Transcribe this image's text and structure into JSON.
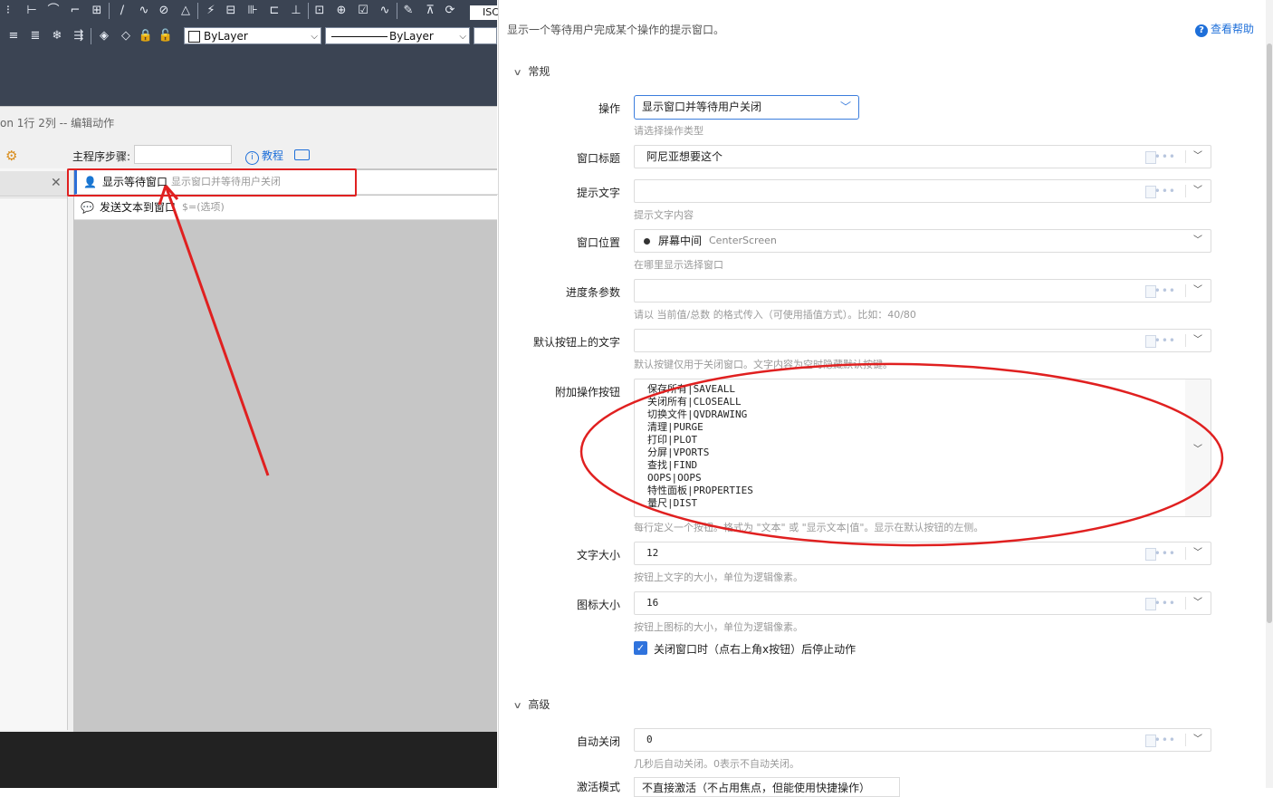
{
  "cad_toolbar": {
    "layer_combo": "ByLayer",
    "linetype_combo": "ByLayer",
    "cut_text": "ISC",
    "icons_row1": [
      "point-icon",
      "line-icon",
      "arc-icon",
      "dimension-icon",
      "polyline-icon",
      "arc2-icon",
      "circle-icon",
      "triangle-icon",
      "break-icon",
      "table-icon",
      "hatch-icon",
      "move-icon",
      "block-icon",
      "insert-icon",
      "check-icon",
      "curve-icon",
      "text-icon",
      "image-icon",
      "refresh-icon"
    ],
    "icons_row2": [
      "layer-icon",
      "layer-state-icon",
      "layer-freeze-icon",
      "layer-match-icon",
      "layer-iso-icon",
      "layer-off-icon",
      "layer-lock-icon",
      "layer-unlock-icon"
    ]
  },
  "editor": {
    "title": "on 1行 2列 -- 编辑动作",
    "main_steps_label": "主程序步骤:",
    "tutorial_label": "教程",
    "steps": [
      {
        "name": "显示等待窗口",
        "desc": "显示窗口并等待用户关闭"
      },
      {
        "name": "发送文本到窗口",
        "desc": "$=(选项)"
      }
    ]
  },
  "panel": {
    "description": "显示一个等待用户完成某个操作的提示窗口。",
    "help_label": "查看帮助",
    "section_general": "常规",
    "section_advanced": "高级",
    "fields": {
      "operation": {
        "label": "操作",
        "value": "显示窗口并等待用户关闭",
        "hint": "请选择操作类型"
      },
      "window_title": {
        "label": "窗口标题",
        "value": "阿尼亚想要这个"
      },
      "prompt_text": {
        "label": "提示文字",
        "value": "",
        "hint": "提示文字内容"
      },
      "window_position": {
        "label": "窗口位置",
        "value": "屏幕中间",
        "value_en": "CenterScreen",
        "hint": "在哪里显示选择窗口"
      },
      "progress_param": {
        "label": "进度条参数",
        "value": "",
        "hint": "请以 当前值/总数 的格式传入（可使用插值方式）。比如：40/80"
      },
      "default_button_text": {
        "label": "默认按钮上的文字",
        "value": "",
        "hint": "默认按键仅用于关闭窗口。文字内容为空时隐藏默认按键。"
      },
      "extra_buttons": {
        "label": "附加操作按钮",
        "lines": [
          "保存所有|SAVEALL",
          "关闭所有|CLOSEALL",
          "切换文件|QVDRAWING",
          "清理|PURGE",
          "打印|PLOT",
          "分屏|VPORTS",
          "查找|FIND",
          "OOPS|OOPS",
          "特性面板|PROPERTIES",
          "量尺|DIST"
        ],
        "hint": "每行定义一个按钮。格式为 \"文本\" 或 \"显示文本|值\"。显示在默认按钮的左侧。"
      },
      "font_size": {
        "label": "文字大小",
        "value": "12",
        "hint": "按钮上文字的大小，单位为逻辑像素。"
      },
      "icon_size": {
        "label": "图标大小",
        "value": "16",
        "hint": "按钮上图标的大小，单位为逻辑像素。"
      },
      "stop_on_close": {
        "label": "关闭窗口时（点右上角x按钮）后停止动作",
        "checked": true
      },
      "auto_close": {
        "label": "自动关闭",
        "value": "0",
        "hint": "几秒后自动关闭。0表示不自动关闭。"
      },
      "activate_mode": {
        "label": "激活模式",
        "value": "不直接激活（不占用焦点，但能使用快捷操作）"
      }
    }
  },
  "colors": {
    "accent": "#1e6fd9",
    "annotation_red": "#e02020",
    "cad_dark": "#3b4453"
  }
}
